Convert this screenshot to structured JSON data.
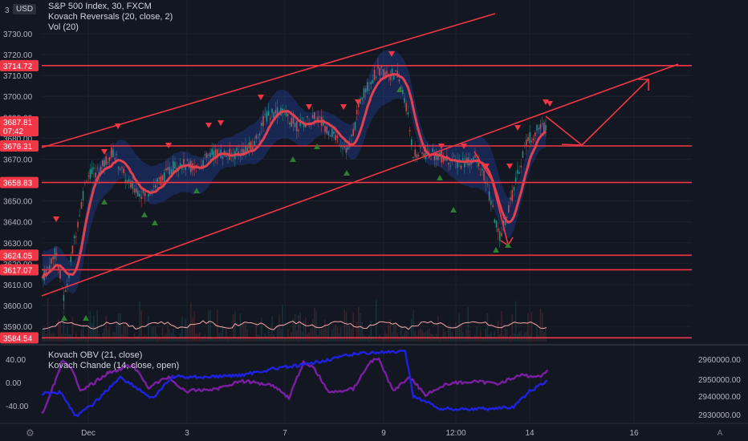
{
  "header": {
    "currency": "USD",
    "symbol_line": "S&P 500 Index, 30, FXCM",
    "indicator_1": "Kovach Reversals (20, close, 2)",
    "indicator_2": "Vol (20)",
    "osc_1": "Kovach OBV (21, close)",
    "osc_2": "Kovach Chande (14, close, open)",
    "axis_partial": "3"
  },
  "price_axis": {
    "ticks": [
      "3730.00",
      "3720.00",
      "3710.00",
      "3700.00",
      "3690.00",
      "3680.00",
      "3670.00",
      "3660.00",
      "3650.00",
      "3640.00",
      "3630.00",
      "3620.00",
      "3610.00",
      "3600.00",
      "3590.00"
    ],
    "tick_values": [
      3730,
      3720,
      3710,
      3700,
      3690,
      3680,
      3670,
      3660,
      3650,
      3640,
      3630,
      3620,
      3610,
      3600,
      3590
    ]
  },
  "price_tags": [
    {
      "label": "3714.72",
      "value": 3714.72,
      "color": "#f23645"
    },
    {
      "label": "3687.81",
      "value": 3687.81,
      "color": "#f23645"
    },
    {
      "label": "07:42",
      "value": 3683.6,
      "color": "#f23645"
    },
    {
      "label": "3676.31",
      "value": 3676.31,
      "color": "#f23645"
    },
    {
      "label": "3658.83",
      "value": 3658.83,
      "color": "#f23645"
    },
    {
      "label": "3624.05",
      "value": 3624.05,
      "color": "#f23645"
    },
    {
      "label": "3617.07",
      "value": 3617.07,
      "color": "#f23645"
    },
    {
      "label": "3584.54",
      "value": 3584.54,
      "color": "#f23645"
    }
  ],
  "time_axis": [
    "Dec",
    "3",
    "7",
    "9",
    "12:00",
    "14",
    "16",
    "A"
  ],
  "osc_axis_left": [
    "40.00",
    "0.00",
    "-40.00"
  ],
  "osc_axis_right": [
    "2960000.00",
    "2950000.00",
    "2940000.00",
    "2930000.00"
  ],
  "chart_data": {
    "type": "candlestick",
    "symbol": "S&P 500 Index",
    "interval": "30",
    "source": "FXCM",
    "ylim": [
      3584,
      3737
    ],
    "horizontal_levels": [
      3714.72,
      3676.31,
      3658.83,
      3624.05,
      3617.07,
      3584.54
    ],
    "last_price": 3687.81,
    "colors": {
      "level": "#f23645",
      "ma": "#e0414f",
      "band": "#2962ff",
      "obv": "#1e22e0",
      "chande": "#7b1fa2",
      "up": "#26a69a",
      "down": "#ef5350"
    }
  }
}
